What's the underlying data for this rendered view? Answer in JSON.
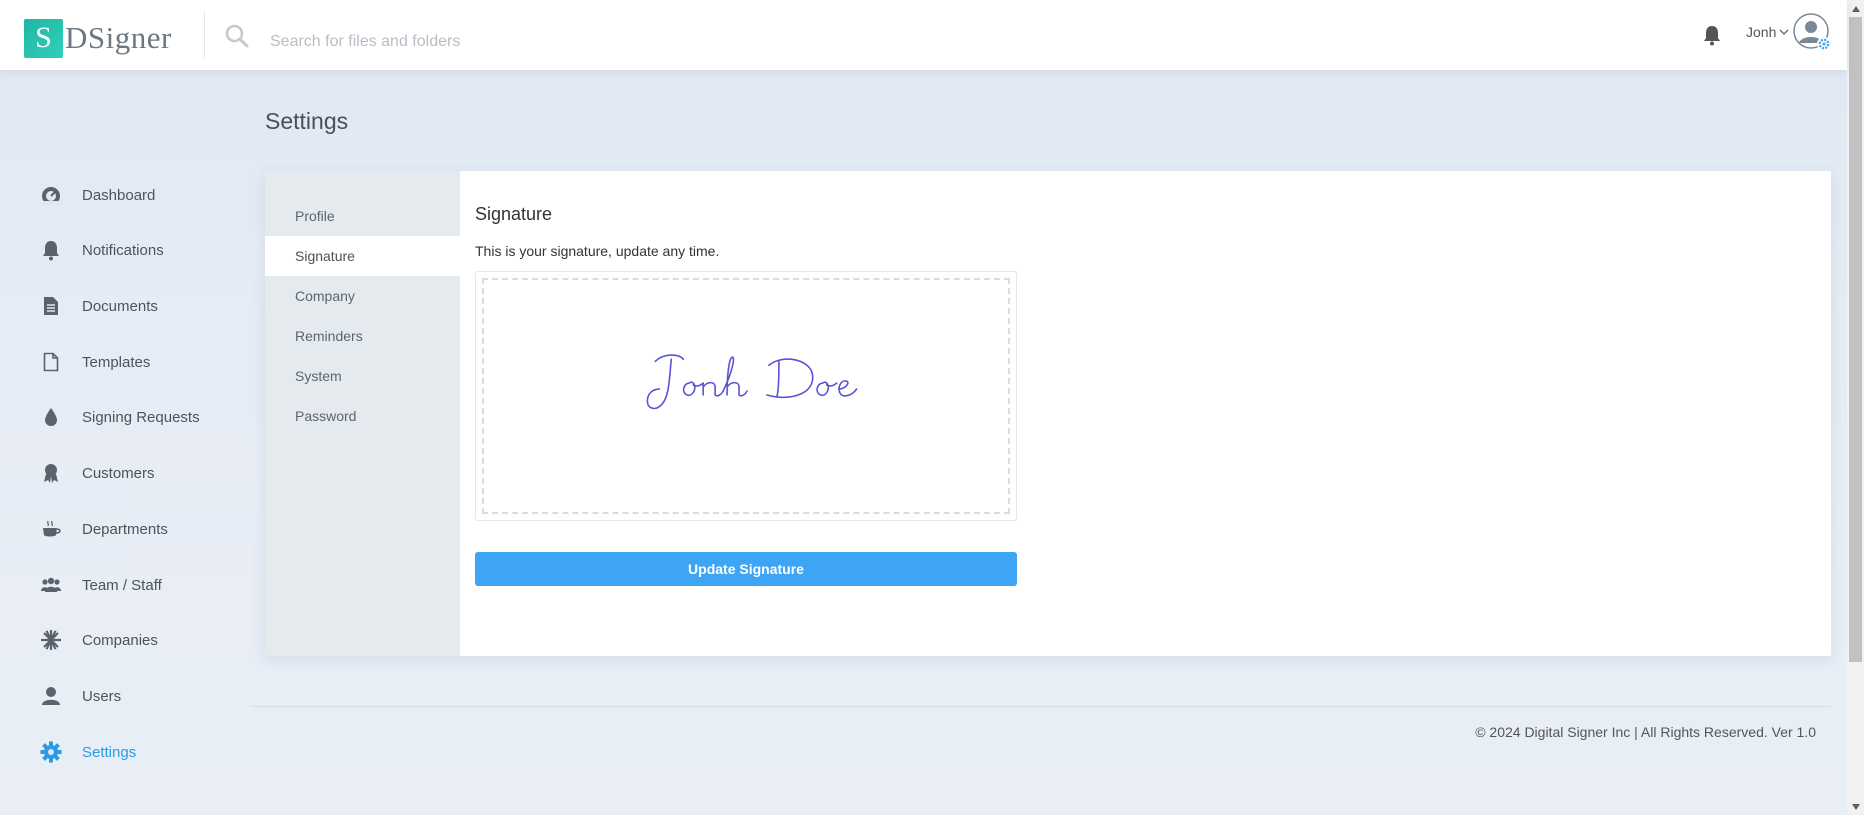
{
  "brand": {
    "mark": "S",
    "name": "DSigner"
  },
  "search": {
    "placeholder": "Search for files and folders"
  },
  "user": {
    "name": "Jonh"
  },
  "sidebar": {
    "items": [
      {
        "label": "Dashboard",
        "icon": "dashboard-icon"
      },
      {
        "label": "Notifications",
        "icon": "bell-icon"
      },
      {
        "label": "Documents",
        "icon": "document-icon"
      },
      {
        "label": "Templates",
        "icon": "template-icon"
      },
      {
        "label": "Signing Requests",
        "icon": "drop-icon"
      },
      {
        "label": "Customers",
        "icon": "award-icon"
      },
      {
        "label": "Departments",
        "icon": "cup-icon"
      },
      {
        "label": "Team / Staff",
        "icon": "team-icon"
      },
      {
        "label": "Companies",
        "icon": "asterisk-icon"
      },
      {
        "label": "Users",
        "icon": "user-icon"
      },
      {
        "label": "Settings",
        "icon": "gear-icon",
        "active": true
      }
    ]
  },
  "page": {
    "title": "Settings"
  },
  "settings_tabs": [
    {
      "label": "Profile"
    },
    {
      "label": "Signature",
      "active": true
    },
    {
      "label": "Company"
    },
    {
      "label": "Reminders"
    },
    {
      "label": "System"
    },
    {
      "label": "Password"
    }
  ],
  "signature": {
    "title": "Signature",
    "description": "This is your signature, update any time.",
    "handwritten_text": "Jonh Doe",
    "ink_color": "#5a52d6",
    "button_label": "Update Signature"
  },
  "footer": {
    "text": "© 2024 Digital Signer Inc | All Rights Reserved. Ver 1.0"
  },
  "colors": {
    "accent": "#3ea4f4",
    "active_nav": "#2a9be0",
    "logo": "#21b5a6"
  }
}
